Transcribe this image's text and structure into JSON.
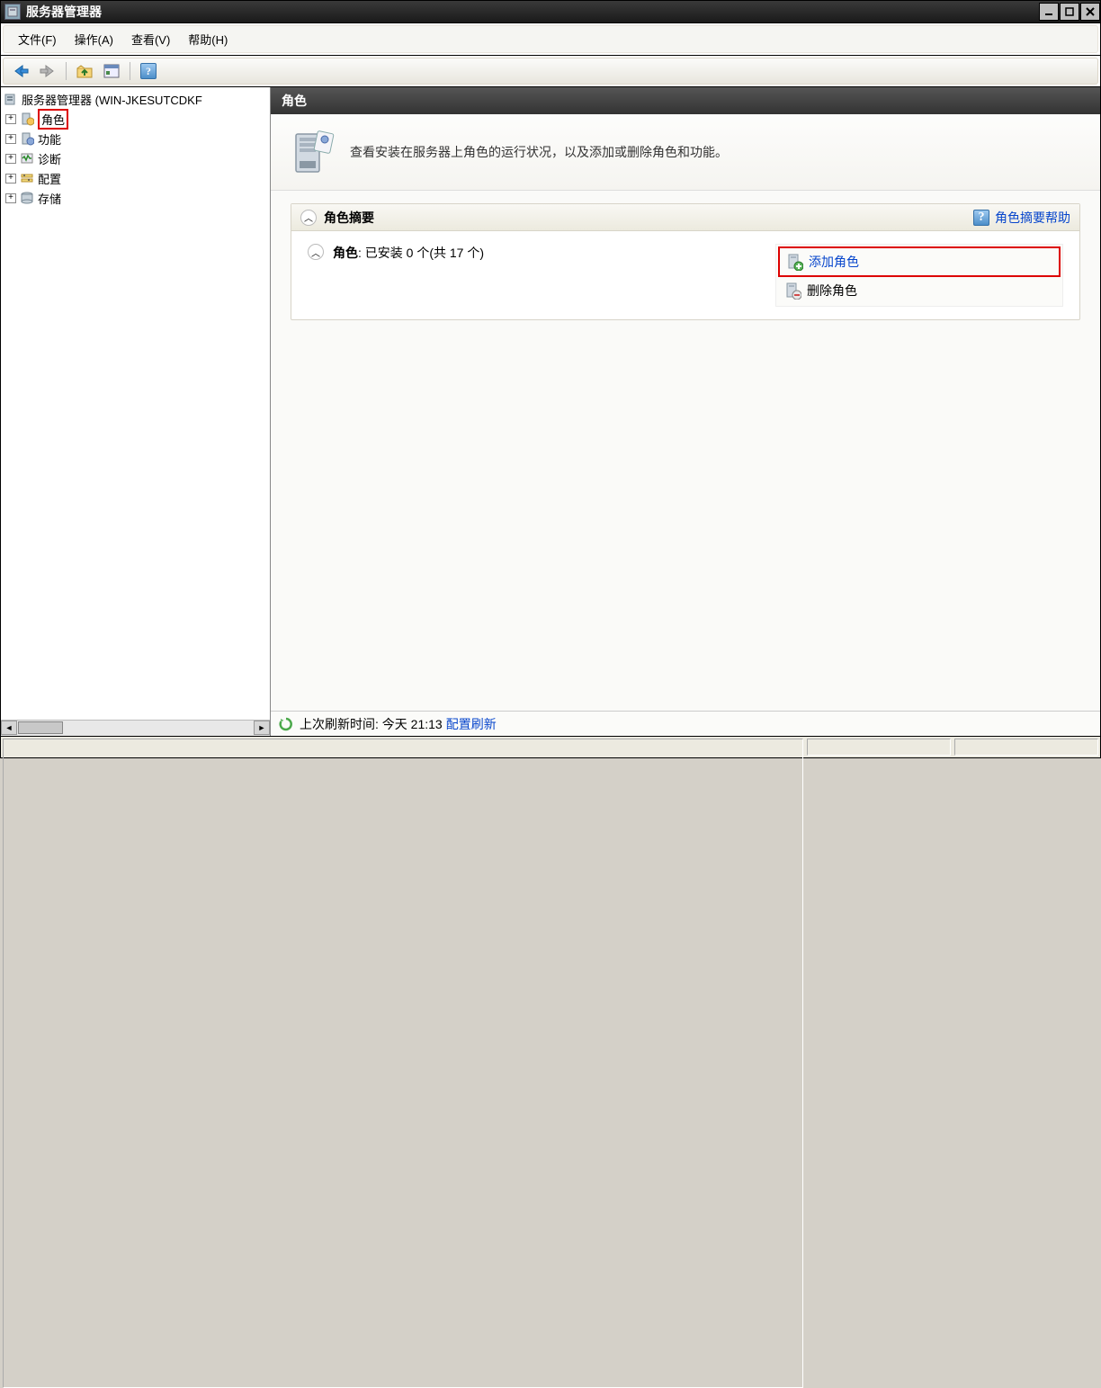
{
  "window": {
    "title": "服务器管理器"
  },
  "menu": {
    "file": "文件(F)",
    "action": "操作(A)",
    "view": "查看(V)",
    "help": "帮助(H)"
  },
  "tree": {
    "root": "服务器管理器 (WIN-JKESUTCDKF",
    "items": [
      {
        "label": "角色"
      },
      {
        "label": "功能"
      },
      {
        "label": "诊断"
      },
      {
        "label": "配置"
      },
      {
        "label": "存储"
      }
    ]
  },
  "content": {
    "header": "角色",
    "banner_text": "查看安装在服务器上角色的运行状况，以及添加或删除角色和功能。",
    "summary_title": "角色摘要",
    "summary_help": "角色摘要帮助",
    "roles_label": "角色",
    "roles_installed_text": "已安装 0 个(共 17 个)",
    "actions": {
      "add": "添加角色",
      "remove": "删除角色"
    },
    "footer_label": "上次刷新时间:",
    "footer_time": "今天 21:13",
    "footer_config": "配置刷新"
  }
}
